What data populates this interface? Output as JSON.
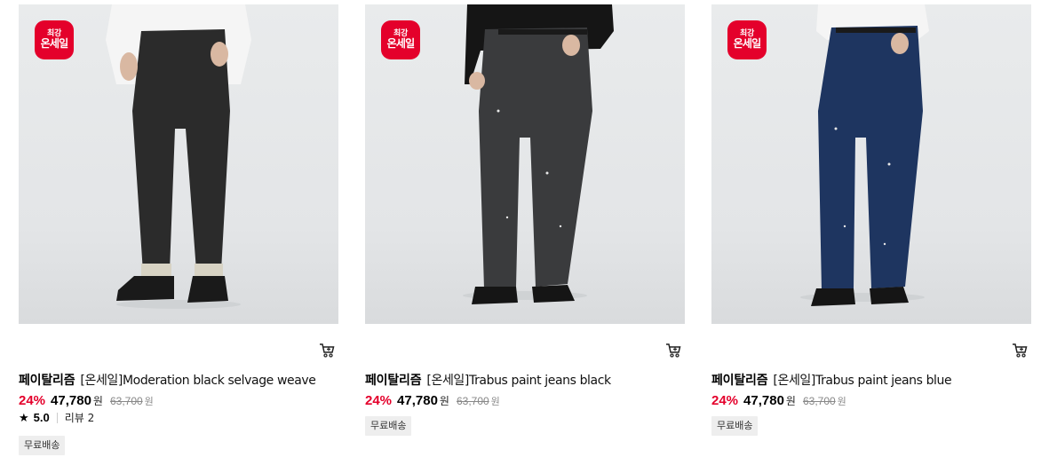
{
  "products": [
    {
      "badge_line1": "최강",
      "badge_line2": "온세일",
      "brand": "페이탈리즘",
      "name": "[온세일]Moderation black selvage weave",
      "discount": "24%",
      "price": "47,780",
      "currency": "원",
      "original_price": "63,700",
      "original_currency": "원",
      "rating": "5.0",
      "review": "리뷰 2",
      "tag": "무료배송",
      "jeans_color": "#2b2b2b"
    },
    {
      "badge_line1": "최강",
      "badge_line2": "온세일",
      "brand": "페이탈리즘",
      "name": "[온세일]Trabus paint jeans black",
      "discount": "24%",
      "price": "47,780",
      "currency": "원",
      "original_price": "63,700",
      "original_currency": "원",
      "tag": "무료배송",
      "jeans_color": "#3a3b3d"
    },
    {
      "badge_line1": "최강",
      "badge_line2": "온세일",
      "brand": "페이탈리즘",
      "name": "[온세일]Trabus paint jeans blue",
      "discount": "24%",
      "price": "47,780",
      "currency": "원",
      "original_price": "63,700",
      "original_currency": "원",
      "tag": "무료배송",
      "jeans_color": "#1e3560"
    }
  ],
  "colors": {
    "badge": "#e4002b",
    "discount": "#e4002b",
    "tag_bg": "#eeeeee"
  },
  "icons": {
    "cart": "cart-icon",
    "star": "star-icon"
  }
}
